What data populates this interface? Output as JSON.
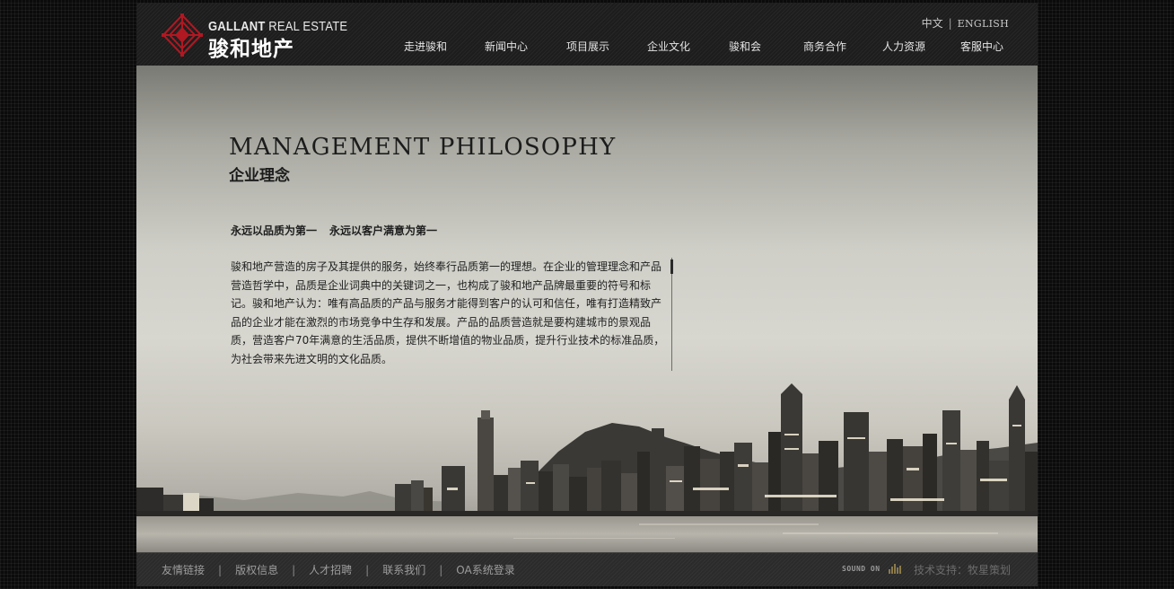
{
  "logo": {
    "brand_bold": "GALLANT",
    "brand_rest": " REAL ESTATE",
    "brand_cn": "骏和地产",
    "mark_color": "#b01822"
  },
  "lang": {
    "cn": "中文",
    "separator": "|",
    "en": "ENGLISH"
  },
  "nav": {
    "items": [
      {
        "label": "走进骏和"
      },
      {
        "label": "新闻中心"
      },
      {
        "label": "项目展示"
      },
      {
        "label": "企业文化"
      },
      {
        "label": "骏和会"
      },
      {
        "label": "商务合作"
      },
      {
        "label": "人力资源"
      },
      {
        "label": "客服中心"
      }
    ]
  },
  "content": {
    "heading_en": "MANAGEMENT PHILOSOPHY",
    "heading_cn": "企业理念",
    "slogan_1": "永远以品质为第一",
    "slogan_2": "永远以客户满意为第一",
    "paragraph": "骏和地产营造的房子及其提供的服务，始终奉行品质第一的理想。在企业的管理理念和产品营造哲学中，品质是企业词典中的关键词之一，也构成了骏和地产品牌最重要的符号和标记。骏和地产认为：唯有高品质的产品与服务才能得到客户的认可和信任，唯有打造精致产品的企业才能在激烈的市场竞争中生存和发展。产品的品质营造就是要构建城市的景观品质，营造客户70年满意的生活品质，提供不断增值的物业品质，提升行业技术的标准品质，为社会带来先进文明的文化品质。"
  },
  "footer": {
    "links": [
      {
        "label": "友情链接"
      },
      {
        "label": "版权信息"
      },
      {
        "label": "人才招聘"
      },
      {
        "label": "联系我们"
      },
      {
        "label": "OA系统登录"
      }
    ],
    "separator": "|",
    "sound_label": "SOUND ON",
    "credit": "技术支持：牧星策划"
  }
}
